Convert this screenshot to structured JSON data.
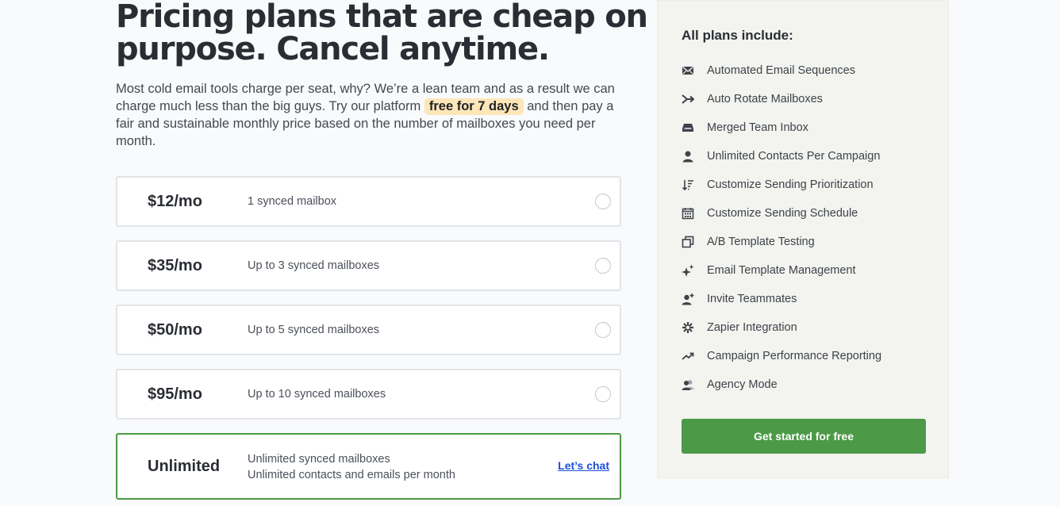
{
  "headline": {
    "line1": "Pricing plans that are cheap on",
    "line2": "purpose. Cancel anytime."
  },
  "intro": {
    "before": "Most cold email tools charge per seat, why? We’re a lean team and as a result we can charge much less than the big guys. Try our platform ",
    "highlight": "free for 7 days",
    "after": " and then pay a fair and sustainable monthly price based on the number of mailboxes you need per month."
  },
  "plans": [
    {
      "price": "$12/mo",
      "description": "1 synced mailbox"
    },
    {
      "price": "$35/mo",
      "description": "Up to 3 synced mailboxes"
    },
    {
      "price": "$50/mo",
      "description": "Up to 5 synced mailboxes"
    },
    {
      "price": "$95/mo",
      "description": "Up to 10 synced mailboxes"
    }
  ],
  "unlimited_plan": {
    "price": "Unlimited",
    "line1": "Unlimited synced mailboxes",
    "line2": "Unlimited contacts and emails per month",
    "chat_label": "Let’s chat"
  },
  "sidebar": {
    "title": "All plans include:",
    "features": [
      {
        "icon": "envelope-icon",
        "label": "Automated Email Sequences"
      },
      {
        "icon": "rotate-arrows-icon",
        "label": "Auto Rotate Mailboxes"
      },
      {
        "icon": "inbox-tray-icon",
        "label": "Merged Team Inbox"
      },
      {
        "icon": "person-icon",
        "label": "Unlimited Contacts Per Campaign"
      },
      {
        "icon": "sort-order-icon",
        "label": "Customize Sending Prioritization"
      },
      {
        "icon": "calendar-icon",
        "label": "Customize Sending Schedule"
      },
      {
        "icon": "copy-template-icon",
        "label": "A/B Template Testing"
      },
      {
        "icon": "sparkles-icon",
        "label": "Email Template Management"
      },
      {
        "icon": "add-person-icon",
        "label": "Invite Teammates"
      },
      {
        "icon": "zapier-asterisk-icon",
        "label": "Zapier Integration"
      },
      {
        "icon": "trending-up-icon",
        "label": "Campaign Performance Reporting"
      },
      {
        "icon": "agency-people-icon",
        "label": "Agency Mode"
      }
    ],
    "cta_label": "Get started for free"
  },
  "colors": {
    "accent_green": "#4c9a47",
    "highlight_bg": "#fde6b8",
    "link_blue": "#1d4fd8"
  }
}
